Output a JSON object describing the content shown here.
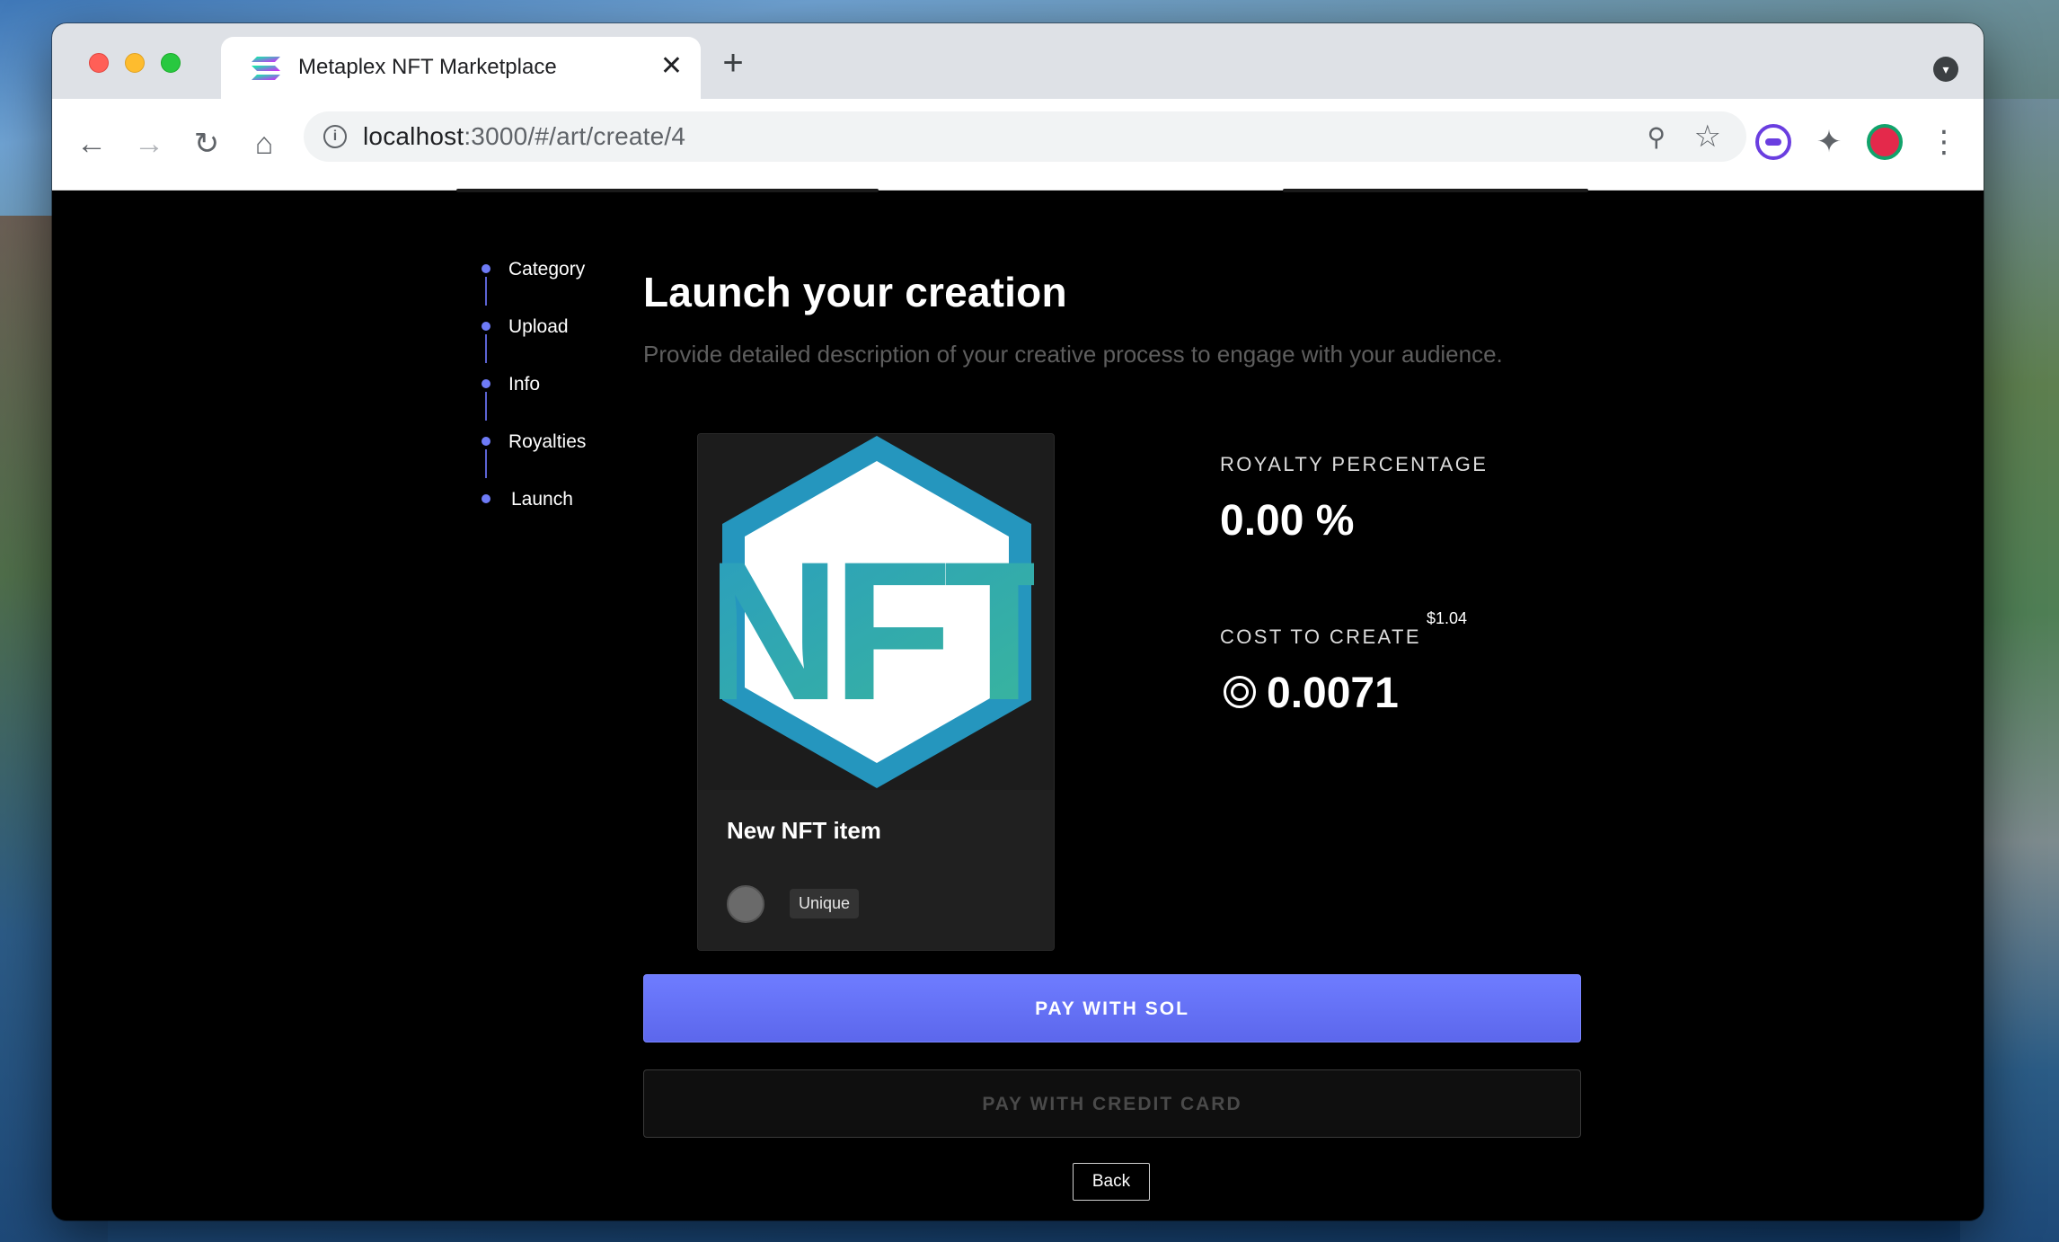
{
  "browser": {
    "tab_title": "Metaplex NFT Marketplace",
    "tab_close": "✕",
    "new_tab": "+",
    "url_host": "localhost",
    "url_path": ":3000/#/art/create/4",
    "icons": {
      "back": "←",
      "forward": "→",
      "reload": "↻",
      "home": "⌂",
      "info": "i",
      "zoom": "⚲",
      "star": "☆",
      "extensions": "✦",
      "menu": "⋮",
      "tab_search": "▾"
    }
  },
  "steps": [
    {
      "label": "Category"
    },
    {
      "label": "Upload"
    },
    {
      "label": "Info"
    },
    {
      "label": "Royalties"
    },
    {
      "label": "Launch"
    }
  ],
  "page": {
    "title": "Launch your creation",
    "subtitle": "Provide detailed description of your creative process to engage with your audience."
  },
  "card": {
    "title": "New NFT item",
    "badge": "Unique",
    "art_text": "NFT"
  },
  "stats": {
    "royalty_label": "ROYALTY PERCENTAGE",
    "royalty_value": "0.00 %",
    "cost_label": "COST TO CREATE",
    "cost_usd": "$1.04",
    "cost_value": "0.0071"
  },
  "actions": {
    "pay_sol": "PAY WITH SOL",
    "pay_card": "PAY WITH CREDIT CARD",
    "back": "Back"
  },
  "colors": {
    "accent": "#6e7bf7",
    "nft_teal": "#2a9dc0",
    "nft_green": "#3ab79a"
  }
}
